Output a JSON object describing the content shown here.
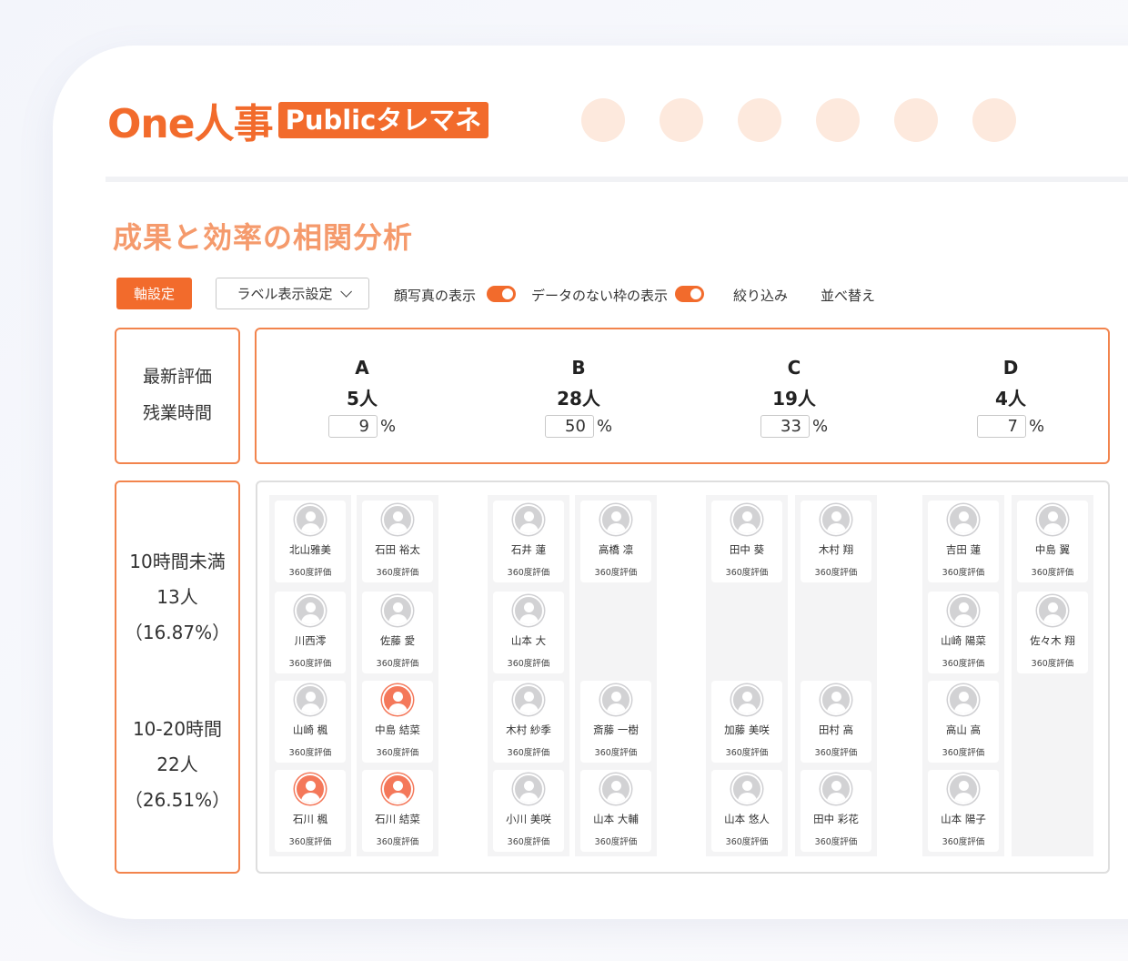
{
  "header": {
    "logo_text": "One人事",
    "logo_badge": "Publicタレマネ"
  },
  "page_title": "成果と効率の相関分析",
  "toolbar": {
    "axis_button": "軸設定",
    "label_select": "ラベル表示設定",
    "photo_toggle_label": "顔写真の表示",
    "empty_toggle_label": "データのない枠の表示",
    "filter_label": "絞り込み",
    "sort_label": "並べ替え"
  },
  "axes": {
    "x_label": "最新評価",
    "y_label": "残業時間"
  },
  "grades": [
    {
      "label": "A",
      "count": "5人",
      "percent": "9",
      "unit": "%"
    },
    {
      "label": "B",
      "count": "28人",
      "percent": "50",
      "unit": "%"
    },
    {
      "label": "C",
      "count": "19人",
      "percent": "33",
      "unit": "%"
    },
    {
      "label": "D",
      "count": "4人",
      "percent": "7",
      "unit": "%"
    }
  ],
  "rows": [
    {
      "label": "10時間未満",
      "count": "13人",
      "percent": "（16.87%）"
    },
    {
      "label": "10-20時間",
      "count": "22人",
      "percent": "（26.51%）"
    }
  ],
  "eval_label": "360度評価",
  "columns": [
    {
      "cards": [
        {
          "name": "北山雅美",
          "slot": 0
        },
        {
          "name": "川西澪",
          "slot": 1
        },
        {
          "name": "山崎 楓",
          "slot": 2
        },
        {
          "name": "石川 楓",
          "slot": 3,
          "highlight": true
        }
      ]
    },
    {
      "cards": [
        {
          "name": "石田 裕太",
          "slot": 0
        },
        {
          "name": "佐藤 愛",
          "slot": 1
        },
        {
          "name": "中島 結菜",
          "slot": 2,
          "highlight": true
        },
        {
          "name": "石川 結菜",
          "slot": 3,
          "highlight": true
        }
      ]
    },
    {
      "cards": [
        {
          "name": "石井 蓮",
          "slot": 0
        },
        {
          "name": "山本 大",
          "slot": 1
        },
        {
          "name": "木村 紗季",
          "slot": 2
        },
        {
          "name": "小川 美咲",
          "slot": 3
        }
      ]
    },
    {
      "cards": [
        {
          "name": "高橋 凛",
          "slot": 0
        },
        {
          "name": "斎藤 一樹",
          "slot": 2
        },
        {
          "name": "山本 大輔",
          "slot": 3
        }
      ]
    },
    {
      "cards": [
        {
          "name": "田中 葵",
          "slot": 0
        },
        {
          "name": "加藤 美咲",
          "slot": 2
        },
        {
          "name": "山本 悠人",
          "slot": 3
        }
      ]
    },
    {
      "cards": [
        {
          "name": "木村 翔",
          "slot": 0
        },
        {
          "name": "田村 高",
          "slot": 2
        },
        {
          "name": "田中 彩花",
          "slot": 3
        }
      ]
    },
    {
      "cards": [
        {
          "name": "吉田 蓮",
          "slot": 0
        },
        {
          "name": "山崎 陽菜",
          "slot": 1
        },
        {
          "name": "高山 高",
          "slot": 2
        },
        {
          "name": "山本 陽子",
          "slot": 3
        }
      ]
    },
    {
      "cards": [
        {
          "name": "中島 翼",
          "slot": 0
        },
        {
          "name": "佐々木 翔",
          "slot": 1
        }
      ]
    }
  ]
}
